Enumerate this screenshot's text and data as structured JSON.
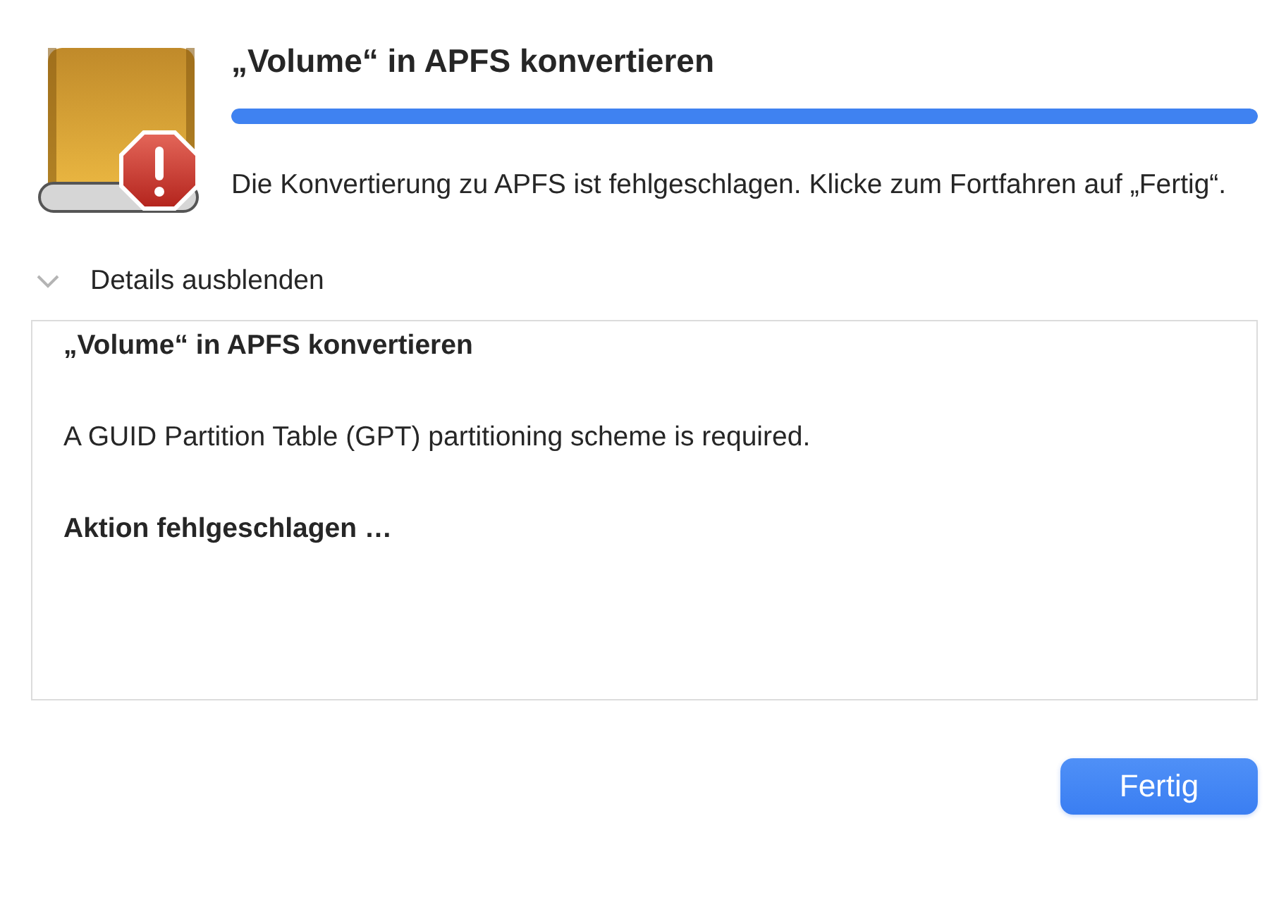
{
  "dialog": {
    "title": "„Volume“ in APFS konvertieren",
    "progress": {
      "level": 1
    },
    "message": "Die Konvertierung zu APFS ist fehlgeschlagen. Klicke zum Fortfahren auf „Fertig“."
  },
  "details": {
    "label": "Details ausblenden",
    "expanded": true,
    "log": [
      {
        "kind": "heading",
        "text": "„Volume“ in APFS konvertieren"
      },
      {
        "kind": "plain",
        "text": "A GUID Partition Table (GPT) partitioning scheme is required."
      },
      {
        "kind": "heading",
        "text": "Aktion fehlgeschlagen …"
      }
    ]
  },
  "buttons": [
    {
      "label": "Fertig",
      "kind": "primary"
    }
  ]
}
